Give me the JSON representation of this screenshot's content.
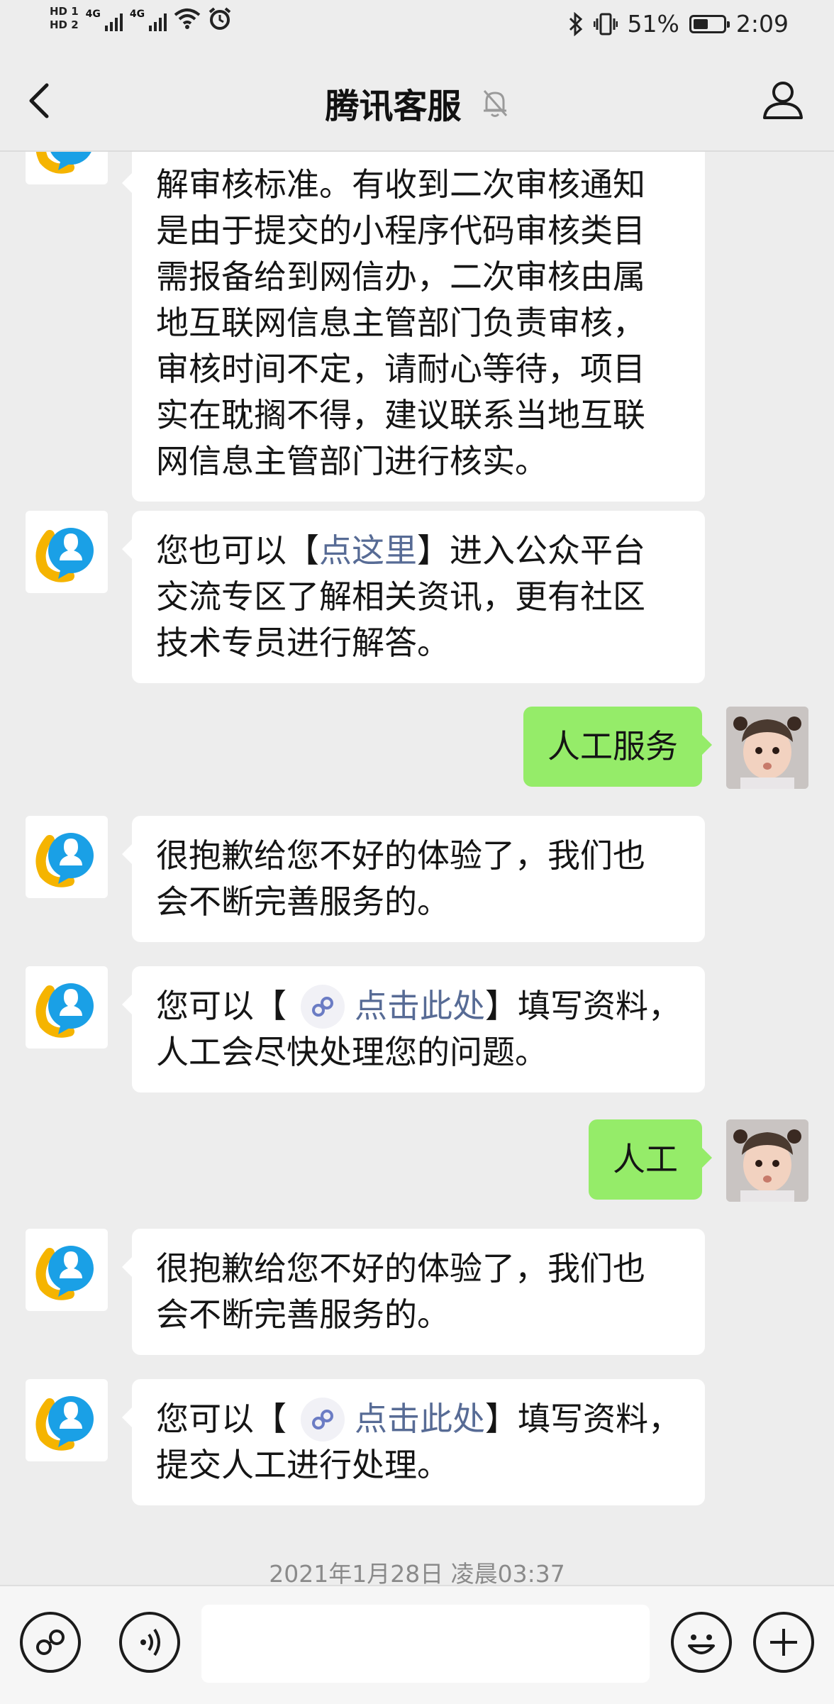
{
  "status_bar": {
    "hd1": "HD 1",
    "hd2": "HD 2",
    "network1": "4G",
    "network2": "4G",
    "battery_percent": "51%",
    "battery_level": 0.51,
    "time": "2:09"
  },
  "header": {
    "title": "腾讯客服"
  },
  "messages": [
    {
      "sender": "bot",
      "text": "解审核标准。有收到二次审核通知\n是由于提交的小程序代码审核类目\n需报备给到网信办，二次审核由属\n地互联网信息主管部门负责审核，\n审核时间不定，请耐心等待，项目\n实在耽搁不得，建议联系当地互联\n网信息主管部门进行核实。"
    },
    {
      "sender": "bot",
      "before": "您也可以【",
      "link": "点这里",
      "after": "】进入公众平台\n交流专区了解相关资讯，更有社区\n技术专员进行解答。"
    },
    {
      "sender": "user",
      "text": "人工服务"
    },
    {
      "sender": "bot",
      "text": "很抱歉给您不好的体验了，我们也\n会不断完善服务的。"
    },
    {
      "sender": "bot",
      "before": "您可以【",
      "link": "点击此处",
      "after": "】填写资料，\n人工会尽快处理您的问题。"
    },
    {
      "sender": "user",
      "text": "人工"
    },
    {
      "sender": "bot",
      "text": "很抱歉给您不好的体验了，我们也\n会不断完善服务的。"
    },
    {
      "sender": "bot",
      "before": "您可以【",
      "link": "点击此处",
      "after": "】填写资料，\n提交人工进行处理。"
    }
  ],
  "timestamp": "2021年1月28日 凌晨03:37",
  "input": {
    "value": ""
  },
  "icons": {
    "back": "chevron-left-icon",
    "mute": "bell-off-icon",
    "profile": "person-icon",
    "mini_program": "mini-program-icon",
    "voice": "voice-icon",
    "emoji": "emoji-icon",
    "add": "plus-icon"
  },
  "colors": {
    "background": "#ededed",
    "user_bubble": "#95ec69",
    "bot_bubble": "#ffffff",
    "link": "#576b95"
  }
}
